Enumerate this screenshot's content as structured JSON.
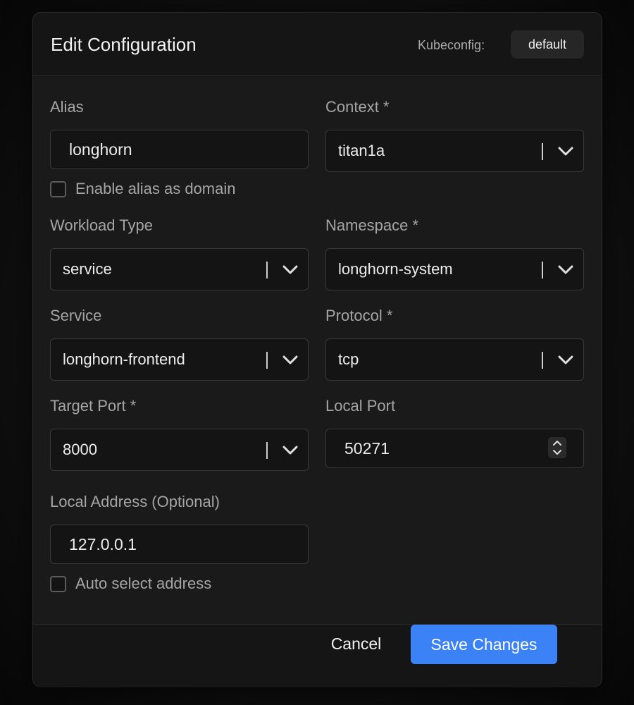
{
  "dialog": {
    "title": "Edit Configuration",
    "kubeconfig_label": "Kubeconfig:",
    "kubeconfig_value": "default"
  },
  "form": {
    "alias": {
      "label": "Alias",
      "value": "longhorn"
    },
    "enable_alias_domain": {
      "label": "Enable alias as domain",
      "checked": false
    },
    "context": {
      "label": "Context *",
      "value": "titan1a"
    },
    "workload_type": {
      "label": "Workload Type",
      "value": "service"
    },
    "namespace": {
      "label": "Namespace *",
      "value": "longhorn-system"
    },
    "service": {
      "label": "Service",
      "value": "longhorn-frontend"
    },
    "protocol": {
      "label": "Protocol *",
      "value": "tcp"
    },
    "target_port": {
      "label": "Target Port *",
      "value": "8000"
    },
    "local_port": {
      "label": "Local Port",
      "value": "50271"
    },
    "local_address": {
      "label": "Local Address (Optional)",
      "value": "127.0.0.1"
    },
    "auto_select_address": {
      "label": "Auto select address",
      "checked": false
    }
  },
  "footer": {
    "cancel_label": "Cancel",
    "save_label": "Save Changes"
  },
  "colors": {
    "accent": "#3b82f6",
    "background": "#1a1a1a",
    "input_bg": "#141414",
    "border": "#383838"
  },
  "icons": {
    "select_chevron": "chevron-down-icon",
    "number_stepper": "up-down-stepper-icon"
  }
}
